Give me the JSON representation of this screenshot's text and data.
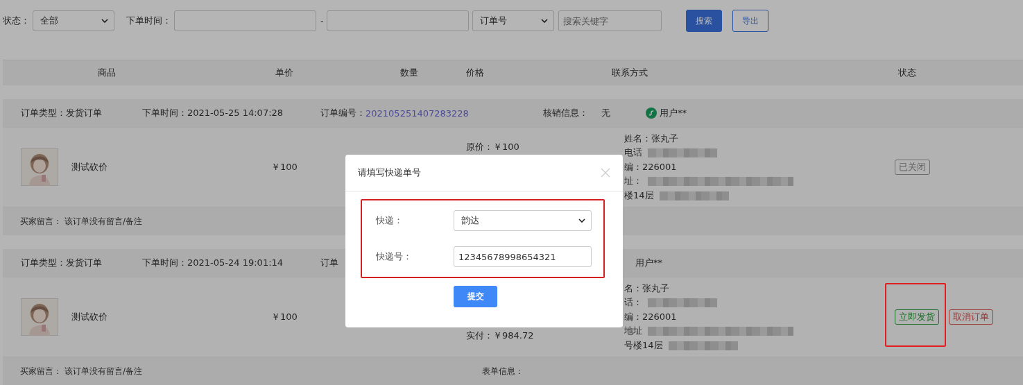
{
  "filters": {
    "status_label": "状态：",
    "status_value": "全部",
    "time_label": "下单时间：",
    "time_separator": "-",
    "search_type": "订单号",
    "search_placeholder": "搜索关键字",
    "search_button": "搜索",
    "export_button": "导出"
  },
  "table": {
    "columns": [
      "商品",
      "单价",
      "数量",
      "价格",
      "联系方式",
      "状态"
    ]
  },
  "orders": [
    {
      "type": "订单类型：发货订单",
      "time": "下单时间：2021-05-25 14:07:28",
      "number_label": "订单编号：",
      "number": "202105251407283228",
      "verify_label": "核销信息：",
      "verify_value": "无",
      "user": "用户**",
      "product": "测试砍价",
      "unit_price": "￥100",
      "price_lines": [
        {
          "kind": "original",
          "text": "原价：￥100"
        }
      ],
      "contact_lines": [
        {
          "text": "姓名：张丸子",
          "redacted": false
        },
        {
          "text": "电话",
          "redacted": true
        },
        {
          "text": "编：226001",
          "redacted": false
        },
        {
          "text": "址：",
          "redacted": true
        },
        {
          "text": "楼14层",
          "redacted": true
        }
      ],
      "actions": [
        {
          "kind": "closed",
          "label": "已关闭"
        }
      ],
      "note_label": "买家留言：",
      "note": "该订单没有留言/备注"
    },
    {
      "type": "订单类型：发货订单",
      "time": "下单时间：2021-05-24 19:01:14",
      "number_label": "订单",
      "user": "用户**",
      "product": "测试砍价",
      "unit_price": "￥100",
      "price_lines": [
        {
          "kind": "paid",
          "text": "实付：￥984.72"
        }
      ],
      "contact_lines": [
        {
          "text": "名：张丸子",
          "redacted": false
        },
        {
          "text": "话：",
          "redacted": true
        },
        {
          "text": "编：226001",
          "redacted": false
        },
        {
          "text": "地址",
          "redacted": true
        },
        {
          "text": "号楼14层",
          "redacted": true
        }
      ],
      "actions": [
        {
          "kind": "ship",
          "label": "立即发货"
        },
        {
          "kind": "cancel",
          "label": "取消订单"
        }
      ],
      "note_label": "买家留言：",
      "note": "该订单没有留言/备注",
      "form_label": "表单信息："
    }
  ],
  "dialog": {
    "title": "请填写快递单号",
    "courier_label": "快递：",
    "courier_value": "韵达",
    "number_label": "快递号：",
    "number_value": "12345678998654321",
    "submit": "提交"
  }
}
